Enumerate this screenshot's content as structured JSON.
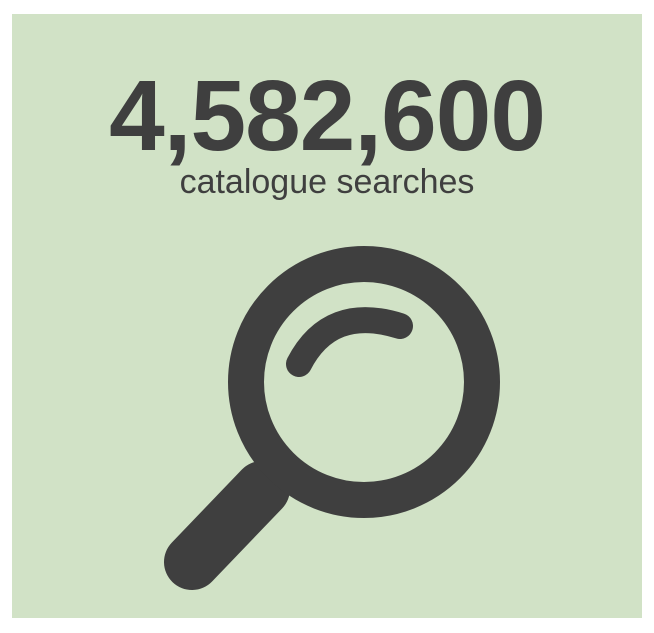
{
  "stat": {
    "value": "4,582,600",
    "label": "catalogue searches"
  },
  "icon": "magnifying-glass-icon",
  "colors": {
    "background": "#d1e2c6",
    "foreground": "#3f3f3f"
  }
}
